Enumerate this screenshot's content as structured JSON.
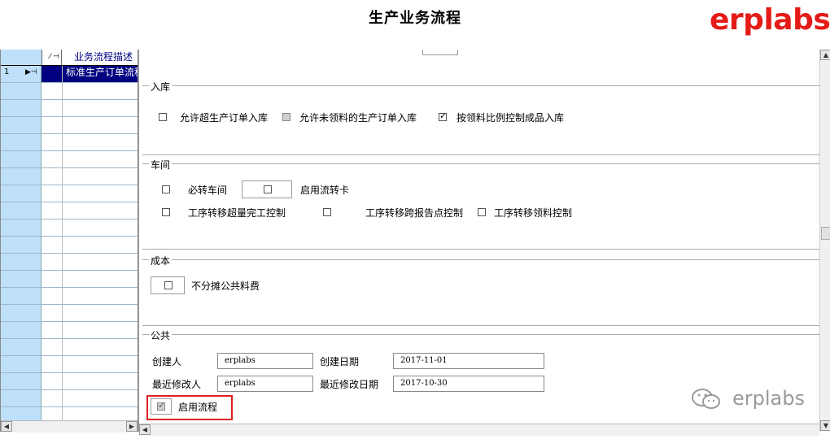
{
  "header": {
    "title": "生产业务流程",
    "brand": "erplabs"
  },
  "grid": {
    "header_pin": "⁄ ⊣",
    "column_desc": "业务流程描述",
    "rows": [
      {
        "number": "1",
        "description": "标准生产订单流程",
        "selected": true
      }
    ]
  },
  "sections": {
    "warehousing": {
      "legend": "入库",
      "options": [
        {
          "label": "允许超生产订单入库",
          "checked": false,
          "disabled": false
        },
        {
          "label": "允许未领料的生产订单入库",
          "checked": false,
          "disabled": true
        },
        {
          "label": "按领料比例控制成品入库",
          "checked": true,
          "disabled": false
        }
      ]
    },
    "workshop": {
      "legend": "车间",
      "options": [
        {
          "label": "必转车间",
          "checked": false
        },
        {
          "label": "启用流转卡",
          "checked": false
        },
        {
          "label": "工序转移超量完工控制",
          "checked": false
        },
        {
          "label": "工序转移跨报告点控制",
          "checked": false
        },
        {
          "label": "工序转移领料控制",
          "checked": false
        }
      ]
    },
    "cost": {
      "legend": "成本",
      "options": [
        {
          "label": "不分摊公共料费",
          "checked": false
        }
      ]
    },
    "public": {
      "legend": "公共",
      "creator_label": "创建人",
      "creator_value": "erplabs",
      "create_date_label": "创建日期",
      "create_date_value": "2017-11-01",
      "modifier_label": "最近修改人",
      "modifier_value": "erplabs",
      "modify_date_label": "最近修改日期",
      "modify_date_value": "2017-10-30",
      "enable_label": "启用流程",
      "enable_checked": true
    }
  },
  "watermark": {
    "text": "erplabs"
  },
  "colors": {
    "brand": "#e41b17",
    "grid_header": "#bfe0fa",
    "selection": "#000080",
    "highlight": "#e02020"
  }
}
